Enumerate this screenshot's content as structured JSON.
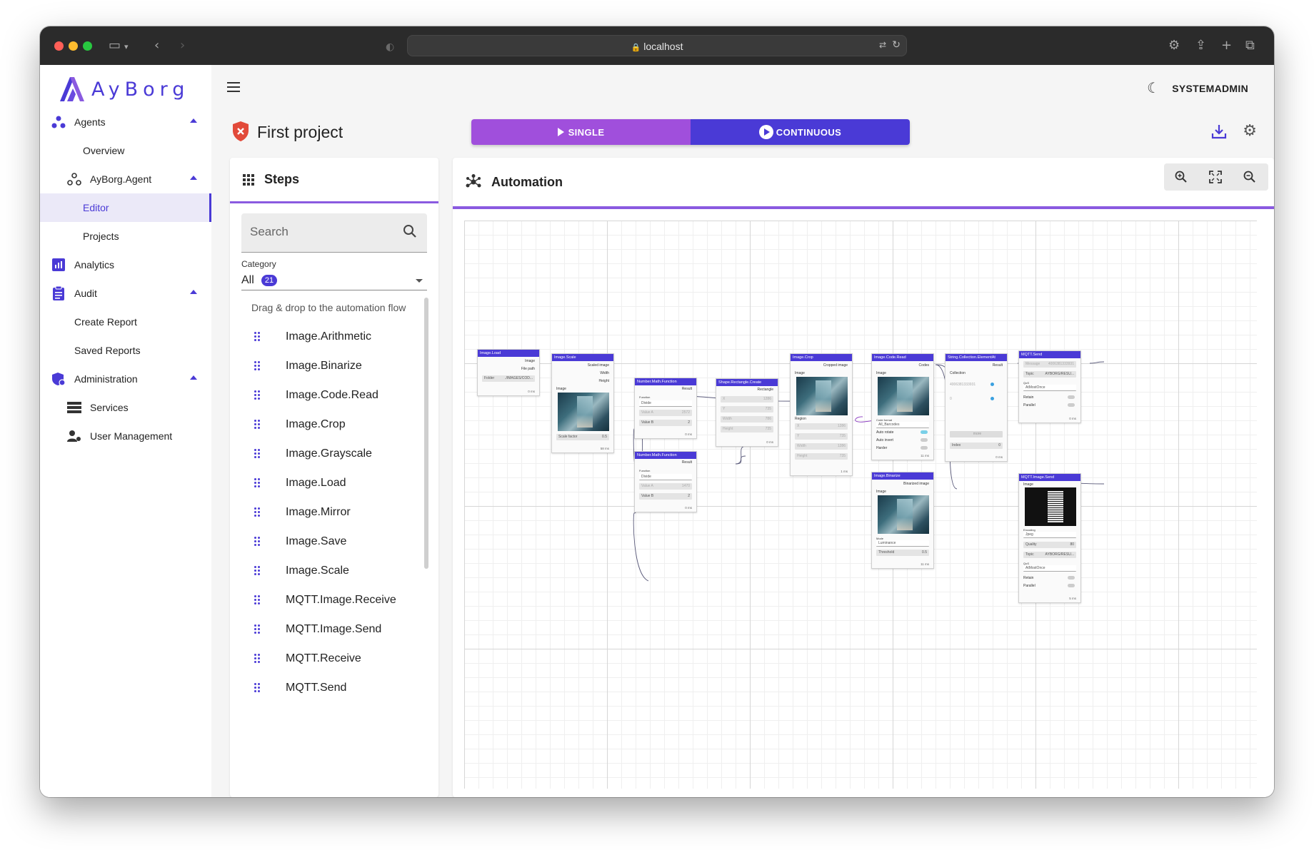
{
  "browser": {
    "url": "localhost"
  },
  "app": {
    "brand": "AyBorg",
    "user": "SYSTEMADMIN"
  },
  "sidebar": {
    "items": [
      {
        "label": "Agents"
      },
      {
        "label": "Overview"
      },
      {
        "label": "AyBorg.Agent"
      },
      {
        "label": "Editor"
      },
      {
        "label": "Projects"
      },
      {
        "label": "Analytics"
      },
      {
        "label": "Audit"
      },
      {
        "label": "Create Report"
      },
      {
        "label": "Saved Reports"
      },
      {
        "label": "Administration"
      },
      {
        "label": "Services"
      },
      {
        "label": "User Management"
      }
    ]
  },
  "project": {
    "title": "First project",
    "single_label": "SINGLE",
    "continuous_label": "CONTINUOUS"
  },
  "steps_panel": {
    "title": "Steps",
    "search_placeholder": "Search",
    "category_label": "Category",
    "category_value": "All",
    "category_count": "21",
    "hint": "Drag & drop to the automation flow",
    "items": [
      "Image.Arithmetic",
      "Image.Binarize",
      "Image.Code.Read",
      "Image.Crop",
      "Image.Grayscale",
      "Image.Load",
      "Image.Mirror",
      "Image.Save",
      "Image.Scale",
      "MQTT.Image.Receive",
      "MQTT.Image.Send",
      "MQTT.Receive",
      "MQTT.Send"
    ]
  },
  "automation_panel": {
    "title": "Automation",
    "nodes": {
      "load": {
        "title": "Image.Load",
        "out1": "Image",
        "out2": "File path",
        "folder": "Folder",
        "folder_val": "./IMAGES/COD...",
        "ms": "0 ms"
      },
      "scale": {
        "title": "Image.Scale",
        "out1": "Scaled image",
        "out2": "Width",
        "out3": "Height",
        "in1": "Image",
        "factor": "Scale factor",
        "factor_val": "0.5",
        "ms": "58 ms"
      },
      "math1": {
        "title": "Number.Math.Function",
        "out": "Result",
        "func": "Function",
        "func_val": "Divide",
        "a": "Value A",
        "a_val": "2572",
        "b": "Value B",
        "b_val": "2",
        "ms": "0 ms"
      },
      "math2": {
        "title": "Number.Math.Function",
        "out": "Result",
        "func": "Function",
        "func_val": "Divide",
        "a": "Value A",
        "a_val": "1470",
        "b": "Value B",
        "b_val": "2",
        "ms": "0 ms"
      },
      "rect": {
        "title": "Shape.Rectangle.Create",
        "out": "Rectangle",
        "x": "X",
        "x_val": "1286",
        "y": "Y",
        "y_val": "735",
        "w": "Width",
        "w_val": "786",
        "h": "Height",
        "h_val": "735",
        "ms": "0 ms"
      },
      "crop": {
        "title": "Image.Crop",
        "out": "Cropped image",
        "in1": "Image",
        "in2": "Region",
        "x": "X",
        "x_val": "1286",
        "y": "Y",
        "y_val": "735",
        "w": "Width",
        "w_val": "1286",
        "h": "Height",
        "h_val": "735",
        "ms": "1 ms"
      },
      "code": {
        "title": "Image.Code.Read",
        "out": "Codes",
        "in": "Image",
        "fmt": "Code format",
        "fmt_val": "All_Barcodes",
        "t1": "Auto rotate",
        "t2": "Auto invert",
        "t3": "Harder",
        "ms": "11 ms"
      },
      "coll": {
        "title": "String.Collection.ElementAt",
        "out": "Result",
        "in": "Collection",
        "val1": "4006381333931",
        "val2": "0",
        "btn": "more",
        "idx": "Index",
        "idx_val": "0",
        "ms": "0 ms"
      },
      "mqtt": {
        "title": "MQTT.Send",
        "msg": "Message",
        "msg_val": "4006381333931",
        "topic": "Topic",
        "topic_val": "AYBORG/RESU...",
        "qos": "QoS",
        "qos_val": "AtMostOnce",
        "retain": "Retain",
        "parallel": "Parallel",
        "ms": "0 ms"
      },
      "bin": {
        "title": "Image.Binarize",
        "out": "Binarized image",
        "in": "Image",
        "mode": "Mode",
        "mode_val": "Luminance",
        "thr": "Threshold",
        "thr_val": "0.5",
        "ms": "11 ms"
      },
      "mqttimg": {
        "title": "MQTT.Image.Send",
        "in": "Image",
        "enc": "Encoding",
        "enc_val": "Jpeg",
        "q": "Quality",
        "q_val": "80",
        "topic": "Topic",
        "topic_val": "AYBORG/RESU...",
        "qos": "QoS",
        "qos_val": "AtMostOnce",
        "retain": "Retain",
        "parallel": "Parallel",
        "ms": "5 ms"
      }
    }
  },
  "colors": {
    "primary": "#4a3ad6",
    "secondary": "#a04fdc",
    "accent_line": "#8a5ae0"
  }
}
